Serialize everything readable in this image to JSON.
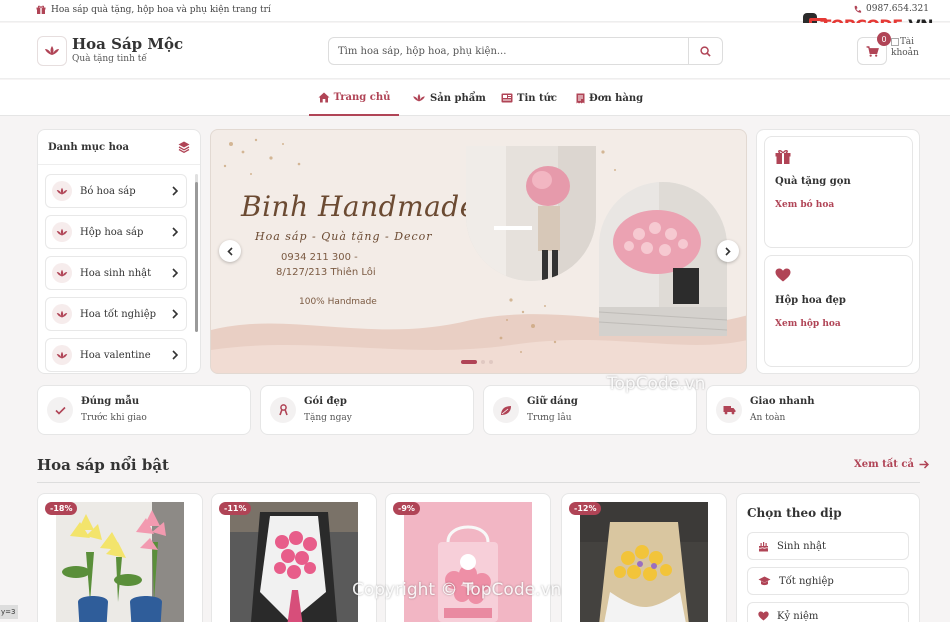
{
  "topbar": {
    "message": "Hoa sáp quà tặng, hộp hoa và phụ kiện trang trí",
    "phone": "0987.654.321"
  },
  "watermark_logo": {
    "text_prefix": "TOPCODE",
    "text_suffix": ".VN"
  },
  "header": {
    "brand_name": "Hoa Sáp Mộc",
    "brand_tagline": "Quà tặng tinh tế",
    "search_placeholder": "Tìm hoa sáp, hộp hoa, phụ kiện...",
    "cart_count": "0",
    "account_alt": "Tài khoản"
  },
  "nav": {
    "items": [
      {
        "label": "Trang chủ",
        "icon": "home-icon",
        "active": true
      },
      {
        "label": "Sản phẩm",
        "icon": "lotus-icon",
        "active": false
      },
      {
        "label": "Tin tức",
        "icon": "newspaper-icon",
        "active": false
      },
      {
        "label": "Đơn hàng",
        "icon": "receipt-icon",
        "active": false
      }
    ]
  },
  "categories": {
    "title": "Danh mục hoa",
    "items": [
      {
        "label": "Bó hoa sáp"
      },
      {
        "label": "Hộp hoa sáp"
      },
      {
        "label": "Hoa sinh nhật"
      },
      {
        "label": "Hoa tốt nghiệp"
      },
      {
        "label": "Hoa valentine"
      }
    ]
  },
  "banner": {
    "title": "Binh Handmade",
    "subtitle": "Hoa sáp - Quà tặng - Decor",
    "phone": "0934 211 300 -",
    "address": "8/127/213 Thiên Lôi",
    "tag": "100% Handmade"
  },
  "promos": [
    {
      "title": "Quà tặng gọn",
      "link": "Xem bó hoa",
      "icon": "gift-icon"
    },
    {
      "title": "Hộp hoa đẹp",
      "link": "Xem hộp hoa",
      "icon": "heart-icon"
    }
  ],
  "features": [
    {
      "title": "Đúng mẫu",
      "subtitle": "Trước khi giao",
      "icon": "check-icon"
    },
    {
      "title": "Gói đẹp",
      "subtitle": "Tặng ngay",
      "icon": "ribbon-icon"
    },
    {
      "title": "Giữ dáng",
      "subtitle": "Trưng lâu",
      "icon": "leaf-icon"
    },
    {
      "title": "Giao nhanh",
      "subtitle": "An toàn",
      "icon": "truck-icon"
    }
  ],
  "featured": {
    "title": "Hoa sáp nổi bật",
    "see_all": "Xem tất cả",
    "products": [
      {
        "discount": "-18%"
      },
      {
        "discount": "-11%"
      },
      {
        "discount": "-9%"
      },
      {
        "discount": "-12%"
      }
    ]
  },
  "occasions": {
    "title": "Chọn theo dịp",
    "items": [
      {
        "label": "Sinh nhật",
        "icon": "cake-icon"
      },
      {
        "label": "Tốt nghiệp",
        "icon": "graduation-cap-icon"
      },
      {
        "label": "Kỷ niệm",
        "icon": "heart-icon"
      }
    ]
  },
  "watermarks": {
    "center": "TopCode.vn",
    "bottom": "Copyright © TopCode.vn"
  },
  "status_text": "y=3",
  "colors": {
    "accent": "#b04456",
    "background": "#f6f4f4"
  }
}
